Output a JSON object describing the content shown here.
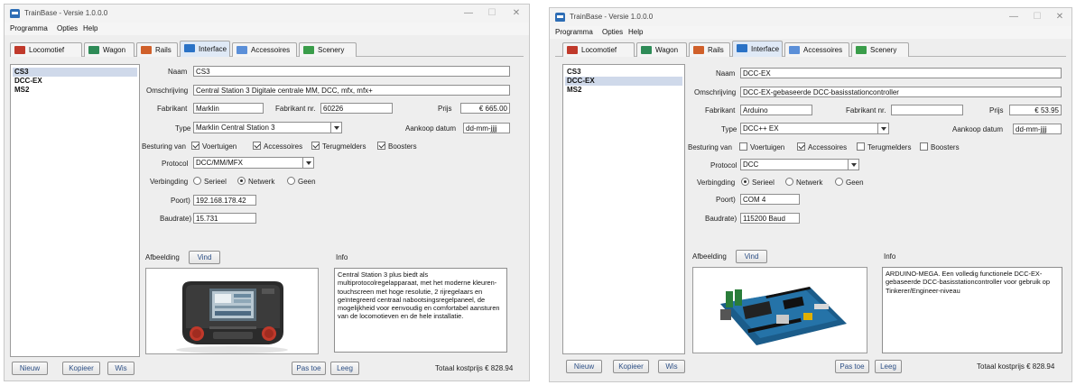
{
  "app": {
    "title": "TrainBase - Versie 1.0.0.0",
    "menu": [
      "Programma",
      "Opties",
      "Help"
    ],
    "window_controls": [
      "—",
      "☐",
      "✕"
    ],
    "tabs": [
      "Locomotief",
      "Wagon",
      "Rails",
      "Interface",
      "Accessoires",
      "Scenery"
    ],
    "active_tab": "Interface"
  },
  "labels": {
    "naam": "Naam",
    "omschrijving": "Omschrijving",
    "fabrikant": "Fabrikant",
    "fabrikant_nr": "Fabrikant nr.",
    "prijs": "Prijs",
    "type": "Type",
    "aankoop_datum": "Aankoop datum",
    "besturing_van": "Besturing van",
    "protocol": "Protocol",
    "verbinding": "Verbingding",
    "poort": "Poort)",
    "baudrate": "Baudrate)",
    "afbeelding": "Afbeelding",
    "info": "Info"
  },
  "buttons": {
    "vind": "Vind",
    "nieuw": "Nieuw",
    "kopieer": "Kopieer",
    "wis": "Wis",
    "pas_toe": "Pas toe",
    "leeg": "Leeg"
  },
  "options": {
    "besturing": [
      "Voertuigen",
      "Accessoires",
      "Terugmelders",
      "Boosters"
    ],
    "verbinding": [
      "Serieel",
      "Netwerk",
      "Geen"
    ]
  },
  "colors": {
    "window_bg": "#eeeeee",
    "selection": "#cfd9ea",
    "active_tab": "#dfe9f6",
    "button_text": "#2c4f86"
  },
  "list_items": [
    "CS3",
    "DCC-EX",
    "MS2"
  ],
  "windows": [
    {
      "selected_item": "CS3",
      "naam": "CS3",
      "omschrijving": "Central Station 3 Digitale centrale MM, DCC, mfx, mfx+",
      "fabrikant": "Marklin",
      "fabrikant_nr": "60226",
      "prijs": "€ 665.00",
      "type": "Marklin Central Station 3",
      "aankoop_datum": "dd-mm-jjjj",
      "besturing_checked": [
        true,
        true,
        true,
        true
      ],
      "protocol": "DCC/MM/MFX",
      "verbinding_selected": "Netwerk",
      "poort": "192.168.178.42",
      "baudrate": "15.731",
      "info": "Central Station 3 plus biedt als multiprotocolregelapparaat, met het moderne kleuren-touchscreen met hoge resolutie, 2 rijregelaars en geïntegreerd centraal nabootsingsregelpaneel, de mogelijkheid voor eenvoudig en comfortabel aansturen van de locomotieven en de hele installatie.",
      "image": "central-station-3-photo",
      "totaal": "Totaal kostprijs € 828.94"
    },
    {
      "selected_item": "DCC-EX",
      "naam": "DCC-EX",
      "omschrijving": "DCC-EX-gebaseerde DCC-basisstationcontroller",
      "fabrikant": "Arduino",
      "fabrikant_nr": "",
      "prijs": "€ 53.95",
      "type": "DCC++ EX",
      "aankoop_datum": "dd-mm-jjjj",
      "besturing_checked": [
        false,
        true,
        false,
        false
      ],
      "protocol": "DCC",
      "verbinding_selected": "Serieel",
      "poort": "COM 4",
      "baudrate": "115200 Baud",
      "info": "ARDUINO-MEGA. Een volledig functionele DCC-EX-gebaseerde DCC-basisstationcontroller voor gebruik op Tinkerer/Engineer-niveau",
      "image": "arduino-mega-board-photo",
      "totaal": "Totaal kostprijs € 828.94"
    }
  ]
}
